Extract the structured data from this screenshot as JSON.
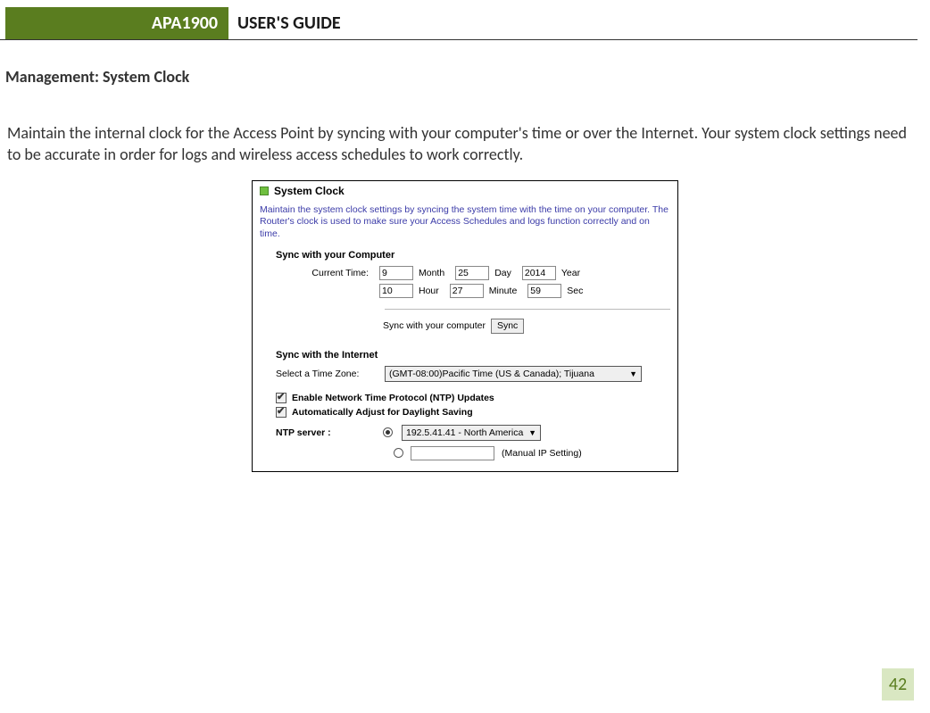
{
  "header": {
    "product": "APA1900",
    "guide": "USER'S GUIDE"
  },
  "section_heading": "Management: System Clock",
  "body_paragraph": "Maintain the internal clock for the Access Point by syncing with your computer's time or over the Internet. Your system clock settings need to be accurate in order for logs and wireless access schedules to work correctly.",
  "panel": {
    "title": "System Clock",
    "description": "Maintain the system clock settings by syncing the system time with the time on your computer. The Router's clock is used to make sure your Access Schedules and logs function correctly and on time.",
    "sync_computer_heading": "Sync with your Computer",
    "current_time_label": "Current Time:",
    "date": {
      "month": "9",
      "day": "25",
      "year": "2014"
    },
    "time": {
      "hour": "10",
      "minute": "27",
      "sec": "59"
    },
    "units": {
      "month": "Month",
      "day": "Day",
      "year": "Year",
      "hour": "Hour",
      "minute": "Minute",
      "sec": "Sec"
    },
    "sync_label_inline": "Sync with your computer",
    "sync_button": "Sync",
    "sync_internet_heading": "Sync with the Internet",
    "tz_label": "Select a Time Zone:",
    "tz_value": "(GMT-08:00)Pacific Time (US & Canada); Tijuana",
    "ntp_enable_label": "Enable Network Time Protocol (NTP) Updates",
    "dst_label": "Automatically Adjust for Daylight Saving",
    "ntp_server_label": "NTP server :",
    "ntp_server_value": "192.5.41.41 - North America",
    "manual_ip_label": "(Manual IP Setting)"
  },
  "page_number": "42"
}
